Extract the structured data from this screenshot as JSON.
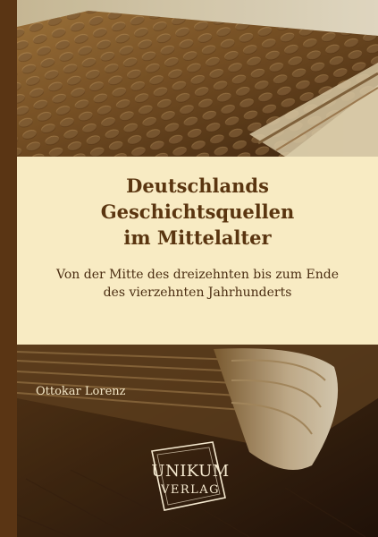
{
  "book": {
    "title_lines": [
      "Deutschlands",
      "Geschichtsquellen",
      "im Mittelalter"
    ],
    "subtitle_lines": [
      "Von der Mitte des dreizehnten bis zum Ende",
      "des vierzehnten Jahrhunderts"
    ],
    "author": "Ottokar Lorenz"
  },
  "publisher": {
    "logo_line1": "UNIKUM",
    "logo_line2": "VERLAG"
  },
  "colors": {
    "band": "#f8ebc3",
    "title": "#5a3510",
    "spine": "#5a3514",
    "author_text": "#f3e6c6"
  }
}
